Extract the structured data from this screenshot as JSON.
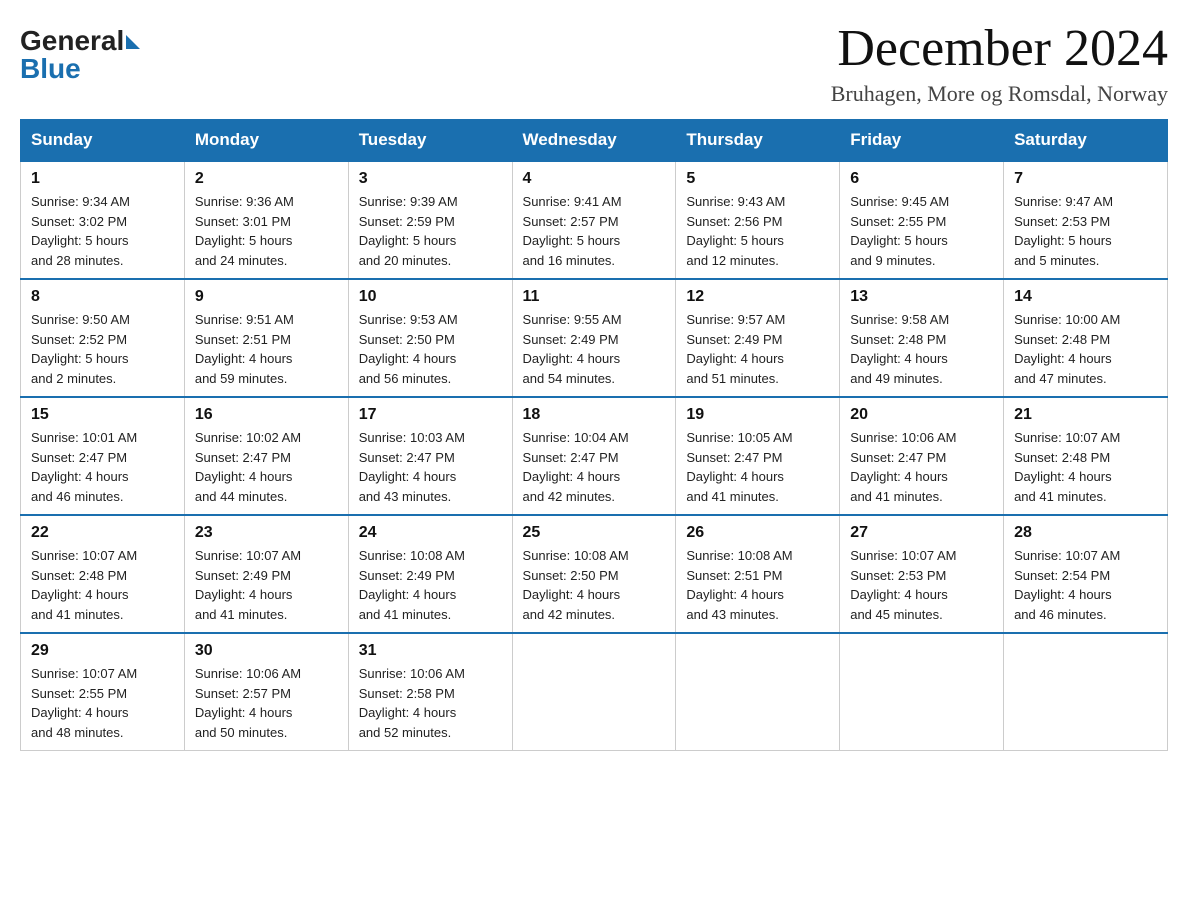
{
  "header": {
    "logo_general": "General",
    "logo_blue": "Blue",
    "month_title": "December 2024",
    "location": "Bruhagen, More og Romsdal, Norway"
  },
  "days_of_week": [
    "Sunday",
    "Monday",
    "Tuesday",
    "Wednesday",
    "Thursday",
    "Friday",
    "Saturday"
  ],
  "weeks": [
    [
      {
        "day": "1",
        "sunrise": "9:34 AM",
        "sunset": "3:02 PM",
        "daylight": "5 hours and 28 minutes."
      },
      {
        "day": "2",
        "sunrise": "9:36 AM",
        "sunset": "3:01 PM",
        "daylight": "5 hours and 24 minutes."
      },
      {
        "day": "3",
        "sunrise": "9:39 AM",
        "sunset": "2:59 PM",
        "daylight": "5 hours and 20 minutes."
      },
      {
        "day": "4",
        "sunrise": "9:41 AM",
        "sunset": "2:57 PM",
        "daylight": "5 hours and 16 minutes."
      },
      {
        "day": "5",
        "sunrise": "9:43 AM",
        "sunset": "2:56 PM",
        "daylight": "5 hours and 12 minutes."
      },
      {
        "day": "6",
        "sunrise": "9:45 AM",
        "sunset": "2:55 PM",
        "daylight": "5 hours and 9 minutes."
      },
      {
        "day": "7",
        "sunrise": "9:47 AM",
        "sunset": "2:53 PM",
        "daylight": "5 hours and 5 minutes."
      }
    ],
    [
      {
        "day": "8",
        "sunrise": "9:50 AM",
        "sunset": "2:52 PM",
        "daylight": "5 hours and 2 minutes."
      },
      {
        "day": "9",
        "sunrise": "9:51 AM",
        "sunset": "2:51 PM",
        "daylight": "4 hours and 59 minutes."
      },
      {
        "day": "10",
        "sunrise": "9:53 AM",
        "sunset": "2:50 PM",
        "daylight": "4 hours and 56 minutes."
      },
      {
        "day": "11",
        "sunrise": "9:55 AM",
        "sunset": "2:49 PM",
        "daylight": "4 hours and 54 minutes."
      },
      {
        "day": "12",
        "sunrise": "9:57 AM",
        "sunset": "2:49 PM",
        "daylight": "4 hours and 51 minutes."
      },
      {
        "day": "13",
        "sunrise": "9:58 AM",
        "sunset": "2:48 PM",
        "daylight": "4 hours and 49 minutes."
      },
      {
        "day": "14",
        "sunrise": "10:00 AM",
        "sunset": "2:48 PM",
        "daylight": "4 hours and 47 minutes."
      }
    ],
    [
      {
        "day": "15",
        "sunrise": "10:01 AM",
        "sunset": "2:47 PM",
        "daylight": "4 hours and 46 minutes."
      },
      {
        "day": "16",
        "sunrise": "10:02 AM",
        "sunset": "2:47 PM",
        "daylight": "4 hours and 44 minutes."
      },
      {
        "day": "17",
        "sunrise": "10:03 AM",
        "sunset": "2:47 PM",
        "daylight": "4 hours and 43 minutes."
      },
      {
        "day": "18",
        "sunrise": "10:04 AM",
        "sunset": "2:47 PM",
        "daylight": "4 hours and 42 minutes."
      },
      {
        "day": "19",
        "sunrise": "10:05 AM",
        "sunset": "2:47 PM",
        "daylight": "4 hours and 41 minutes."
      },
      {
        "day": "20",
        "sunrise": "10:06 AM",
        "sunset": "2:47 PM",
        "daylight": "4 hours and 41 minutes."
      },
      {
        "day": "21",
        "sunrise": "10:07 AM",
        "sunset": "2:48 PM",
        "daylight": "4 hours and 41 minutes."
      }
    ],
    [
      {
        "day": "22",
        "sunrise": "10:07 AM",
        "sunset": "2:48 PM",
        "daylight": "4 hours and 41 minutes."
      },
      {
        "day": "23",
        "sunrise": "10:07 AM",
        "sunset": "2:49 PM",
        "daylight": "4 hours and 41 minutes."
      },
      {
        "day": "24",
        "sunrise": "10:08 AM",
        "sunset": "2:49 PM",
        "daylight": "4 hours and 41 minutes."
      },
      {
        "day": "25",
        "sunrise": "10:08 AM",
        "sunset": "2:50 PM",
        "daylight": "4 hours and 42 minutes."
      },
      {
        "day": "26",
        "sunrise": "10:08 AM",
        "sunset": "2:51 PM",
        "daylight": "4 hours and 43 minutes."
      },
      {
        "day": "27",
        "sunrise": "10:07 AM",
        "sunset": "2:53 PM",
        "daylight": "4 hours and 45 minutes."
      },
      {
        "day": "28",
        "sunrise": "10:07 AM",
        "sunset": "2:54 PM",
        "daylight": "4 hours and 46 minutes."
      }
    ],
    [
      {
        "day": "29",
        "sunrise": "10:07 AM",
        "sunset": "2:55 PM",
        "daylight": "4 hours and 48 minutes."
      },
      {
        "day": "30",
        "sunrise": "10:06 AM",
        "sunset": "2:57 PM",
        "daylight": "4 hours and 50 minutes."
      },
      {
        "day": "31",
        "sunrise": "10:06 AM",
        "sunset": "2:58 PM",
        "daylight": "4 hours and 52 minutes."
      },
      null,
      null,
      null,
      null
    ]
  ],
  "labels": {
    "sunrise": "Sunrise:",
    "sunset": "Sunset:",
    "daylight": "Daylight:"
  }
}
